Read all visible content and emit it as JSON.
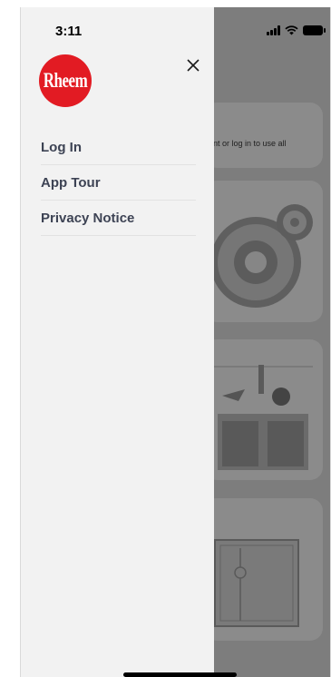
{
  "status_bar": {
    "time": "3:11",
    "icons": [
      "signal-icon",
      "wifi-icon",
      "battery-icon"
    ]
  },
  "drawer": {
    "logo_text": "Rheem",
    "close_icon": "close-icon",
    "menu": [
      {
        "label": "Log In"
      },
      {
        "label": "App Tour"
      },
      {
        "label": "Privacy Notice"
      }
    ]
  },
  "background": {
    "prompt_text": "nt or log in to use all"
  },
  "colors": {
    "brand_red": "#e21b23",
    "drawer_bg": "#f2f2f2",
    "menu_text": "#3d4354",
    "overlay": "#7d7d7d"
  }
}
